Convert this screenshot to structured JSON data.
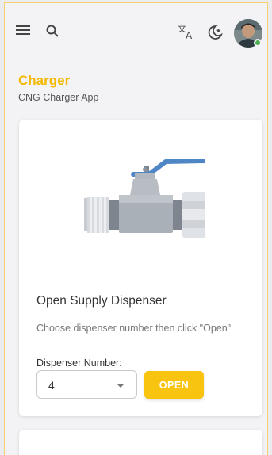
{
  "header": {
    "menu_icon": "hamburger-menu-icon",
    "search_icon": "search-icon",
    "translate_icon": "translate-icon",
    "theme_icon": "dark-mode-moon-icon",
    "avatar_status_color": "#4caf50"
  },
  "page": {
    "title": "Charger",
    "subtitle": "CNG Charger App",
    "accent_color": "#f5b800"
  },
  "card": {
    "heading": "Open Supply Dispenser",
    "description": "Choose dispenser number then click \"Open\"",
    "field_label": "Dispenser Number:",
    "selected_value": "4",
    "button_label": "OPEN",
    "button_color": "#f9c40f",
    "illustration_icon": "gas-valve-icon"
  }
}
